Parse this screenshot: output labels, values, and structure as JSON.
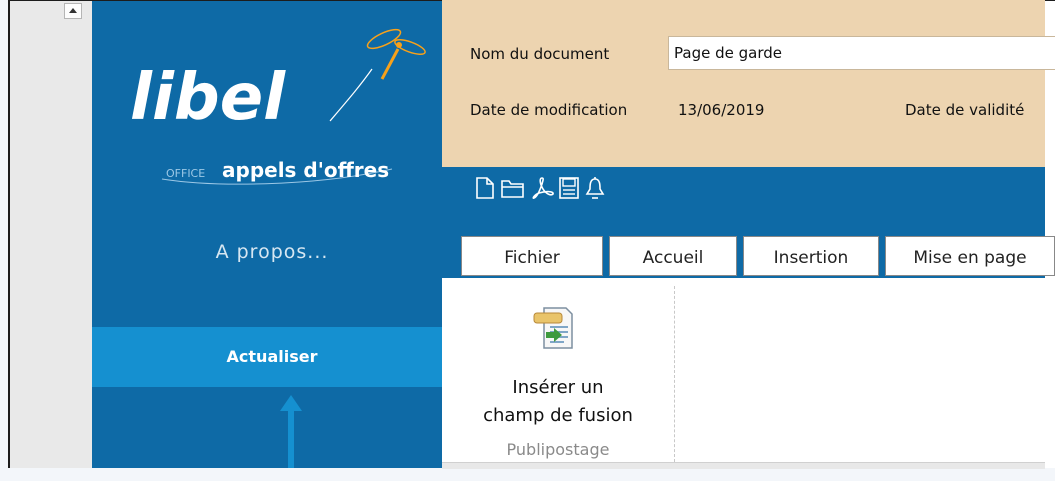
{
  "sidebar": {
    "logo_word": "libel",
    "logo_office": "OFFICE",
    "logo_tagline": "appels d'offres",
    "about_label": "A propos...",
    "refresh_label": "Actualiser"
  },
  "document": {
    "name_label": "Nom du document",
    "name_value": "Page de garde",
    "modified_label": "Date de modification",
    "modified_value": "13/06/2019",
    "validity_label": "Date de validité"
  },
  "toolbar": {
    "icons": [
      "new-document-icon",
      "open-folder-icon",
      "pdf-icon",
      "save-icon",
      "bell-icon"
    ]
  },
  "tabs": [
    "Fichier",
    "Accueil",
    "Insertion",
    "Mise en page"
  ],
  "ribbon": {
    "merge_button_line1": "Insérer un",
    "merge_button_line2": "champ de fusion",
    "group_label": "Publipostage"
  },
  "colors": {
    "sidebar_blue": "#0e6aa6",
    "accent_blue": "#1590d0",
    "header_tan": "#edd4b0",
    "logo_orange": "#f7a11a"
  }
}
